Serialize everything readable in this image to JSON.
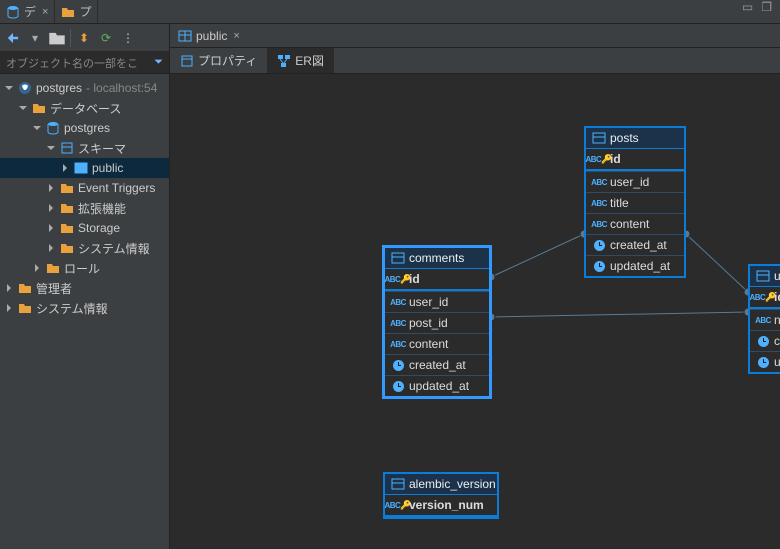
{
  "tabs": {
    "left1": "デ",
    "left2": "プ",
    "editor": "public"
  },
  "subtabs": {
    "properties": "プロパティ",
    "erd": "ER図"
  },
  "search_hint": "オブジェクト名の一部をこ",
  "tree": {
    "root": "postgres",
    "root_host": " - localhost:54",
    "db_group": "データベース",
    "db": "postgres",
    "schema_group": "スキーマ",
    "schema": "public",
    "evt": "Event Triggers",
    "ext": "拡張機能",
    "storage": "Storage",
    "sysinfo": "システム情報",
    "roles": "ロール",
    "admin": "管理者",
    "sysinfo2": "システム情報"
  },
  "er": {
    "posts": {
      "title": "posts",
      "cols": [
        "id",
        "user_id",
        "title",
        "content",
        "created_at",
        "updated_at"
      ]
    },
    "comments": {
      "title": "comments",
      "cols": [
        "id",
        "user_id",
        "post_id",
        "content",
        "created_at",
        "updated_at"
      ]
    },
    "users": {
      "title": "users",
      "cols": [
        "id",
        "name",
        "created_at",
        "updated_at"
      ]
    },
    "alembic": {
      "title": "alembic_version",
      "cols": [
        "version_num"
      ]
    }
  }
}
